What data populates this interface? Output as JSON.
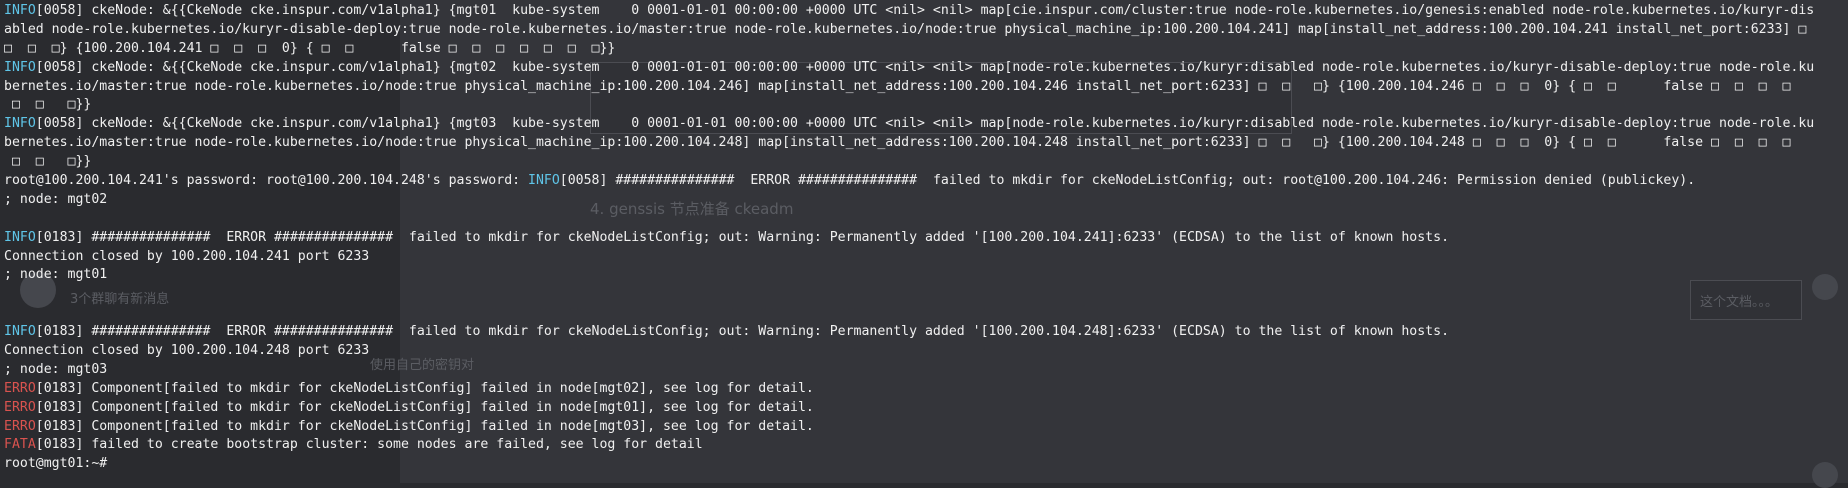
{
  "terminal": {
    "lines": [
      {
        "tag": "INFO",
        "text": "[0058] ckeNode: &{{CkeNode cke.inspur.com/v1alpha1} {mgt01  kube-system    0 0001-01-01 00:00:00 +0000 UTC <nil> <nil> map[cie.inspur.com/cluster:true node-role.kubernetes.io/genesis:enabled node-role.kubernetes.io/kuryr-dis"
      },
      {
        "tag": "",
        "text": "abled node-role.kubernetes.io/kuryr-disable-deploy:true node-role.kubernetes.io/master:true node-role.kubernetes.io/node:true physical_machine_ip:100.200.104.241] map[install_net_address:100.200.104.241 install_net_port:6233] □"
      },
      {
        "tag": "",
        "text": "□  □  □} {100.200.104.241 □  □  □  0} { □  □      false □  □  □  □  □  □  □}}"
      },
      {
        "tag": "INFO",
        "text": "[0058] ckeNode: &{{CkeNode cke.inspur.com/v1alpha1} {mgt02  kube-system    0 0001-01-01 00:00:00 +0000 UTC <nil> <nil> map[node-role.kubernetes.io/kuryr:disabled node-role.kubernetes.io/kuryr-disable-deploy:true node-role.ku"
      },
      {
        "tag": "",
        "text": "bernetes.io/master:true node-role.kubernetes.io/node:true physical_machine_ip:100.200.104.246] map[install_net_address:100.200.104.246 install_net_port:6233] □  □   □} {100.200.104.246 □  □  □  0} { □  □      false □  □  □  □"
      },
      {
        "tag": "",
        "text": " □  □   □}}"
      },
      {
        "tag": "INFO",
        "text": "[0058] ckeNode: &{{CkeNode cke.inspur.com/v1alpha1} {mgt03  kube-system    0 0001-01-01 00:00:00 +0000 UTC <nil> <nil> map[node-role.kubernetes.io/kuryr:disabled node-role.kubernetes.io/kuryr-disable-deploy:true node-role.ku"
      },
      {
        "tag": "",
        "text": "bernetes.io/master:true node-role.kubernetes.io/node:true physical_machine_ip:100.200.104.248] map[install_net_address:100.200.104.248 install_net_port:6233] □  □   □} {100.200.104.248 □  □  □  0} { □  □      false □  □  □  □"
      },
      {
        "tag": "",
        "text": " □  □   □}}"
      },
      {
        "tag": "",
        "text": "root@100.200.104.241's password: root@100.200.104.248's password: ",
        "tag2": "INFO",
        "text2": "[0058] ###############  ERROR ###############  failed to mkdir for ckeNodeListConfig; out: root@100.200.104.246: Permission denied (publickey)."
      },
      {
        "tag": "",
        "text": "; node: mgt02"
      },
      {
        "tag": "",
        "text": ""
      },
      {
        "tag": "INFO",
        "text": "[0183] ###############  ERROR ###############  failed to mkdir for ckeNodeListConfig; out: Warning: Permanently added '[100.200.104.241]:6233' (ECDSA) to the list of known hosts."
      },
      {
        "tag": "",
        "text": "Connection closed by 100.200.104.241 port 6233"
      },
      {
        "tag": "",
        "text": "; node: mgt01"
      },
      {
        "tag": "",
        "text": ""
      },
      {
        "tag": "",
        "text": ""
      },
      {
        "tag": "INFO",
        "text": "[0183] ###############  ERROR ###############  failed to mkdir for ckeNodeListConfig; out: Warning: Permanently added '[100.200.104.248]:6233' (ECDSA) to the list of known hosts."
      },
      {
        "tag": "",
        "text": "Connection closed by 100.200.104.248 port 6233"
      },
      {
        "tag": "",
        "text": "; node: mgt03"
      },
      {
        "tag": "ERRO",
        "text": "[0183] Component[failed to mkdir for ckeNodeListConfig] failed in node[mgt02], see log for detail."
      },
      {
        "tag": "ERRO",
        "text": "[0183] Component[failed to mkdir for ckeNodeListConfig] failed in node[mgt01], see log for detail."
      },
      {
        "tag": "ERRO",
        "text": "[0183] Component[failed to mkdir for ckeNodeListConfig] failed in node[mgt03], see log for detail."
      },
      {
        "tag": "FATA",
        "text": "[0183] failed to create bootstrap cluster: some nodes are failed, see log for detail"
      },
      {
        "tag": "",
        "text": "root@mgt01:~#"
      }
    ]
  },
  "background_window": {
    "heading": "4. genssis 节点准备 ckeadm",
    "chat_items": [
      "3个群聊有新消息",
      "使用自己的密钥对"
    ],
    "bubble_text": "这个文档。。。"
  },
  "colors": {
    "terminal_bg": "#2a2b2f",
    "text": "#f0f0f0",
    "info": "#5fc5e8",
    "error": "#d9534f"
  }
}
